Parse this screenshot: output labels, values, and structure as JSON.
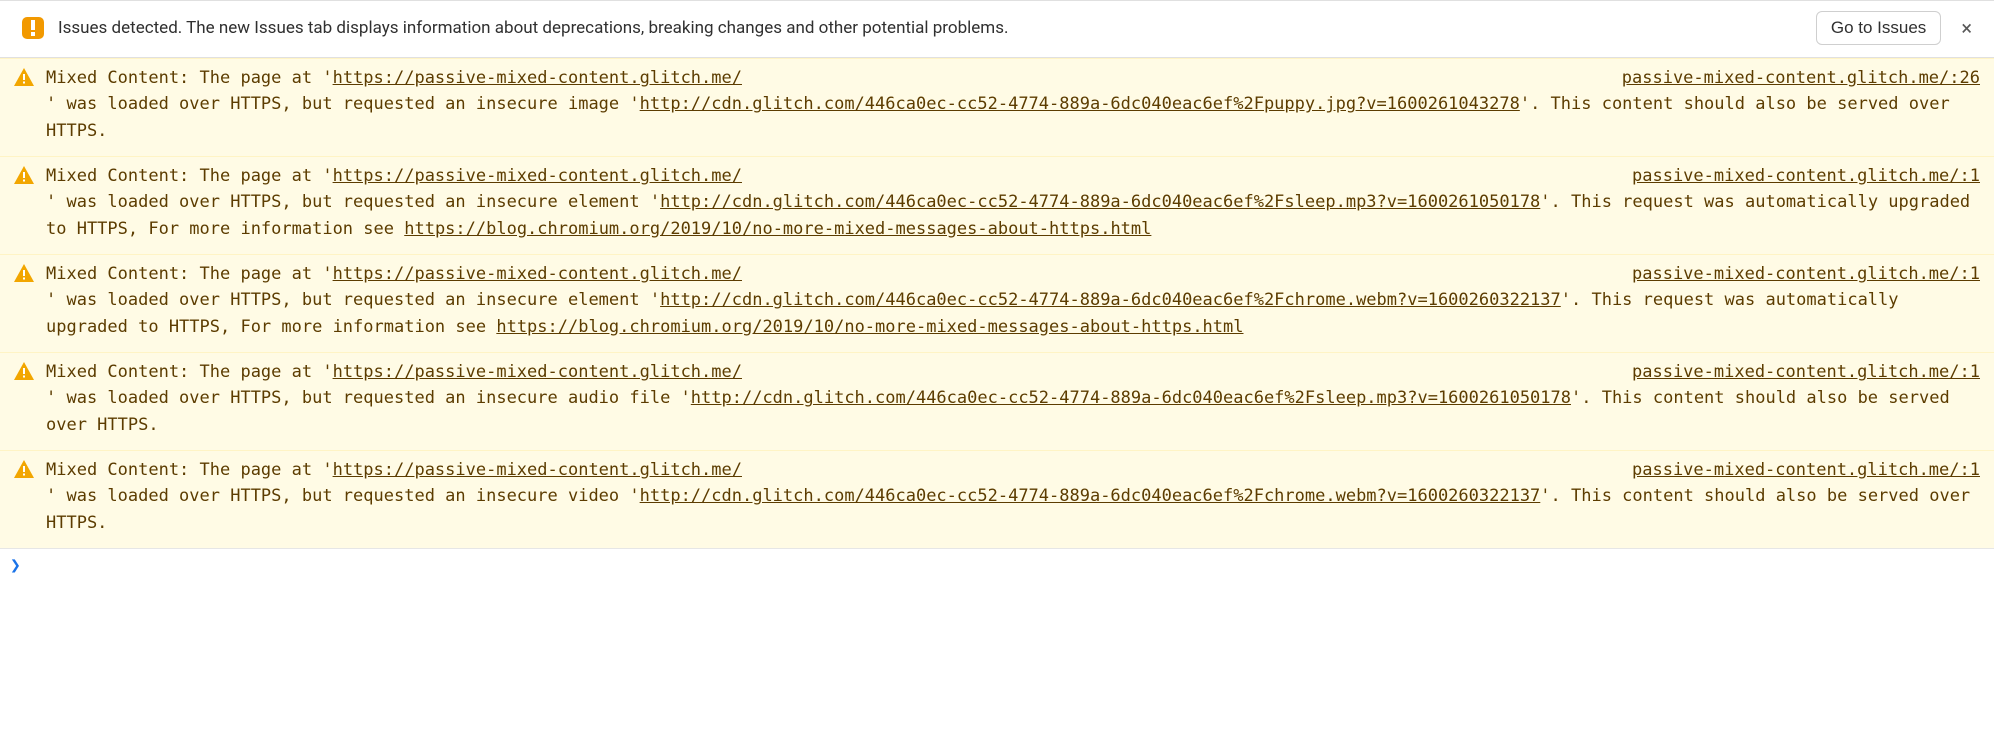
{
  "banner": {
    "text": "Issues detected. The new Issues tab displays information about deprecations, breaking changes and other potential problems.",
    "button": "Go to Issues",
    "close": "×"
  },
  "prompt": {
    "caret": "❯"
  },
  "rows": [
    {
      "source": "passive-mixed-content.glitch.me/:26",
      "parts": [
        {
          "t": "Mixed Content: The page at '"
        },
        {
          "t": "https://passive-mixed-content.glitch.me/",
          "link": true
        },
        {
          "t": "' was loaded over HTTPS, but requested an insecure image '"
        },
        {
          "t": "http://cdn.glitch.com/446ca0ec-cc52-4774-889a-6dc040eac6ef%2Fpuppy.jpg?v=1600261043278",
          "link": true
        },
        {
          "t": "'. This content should also be served over HTTPS."
        }
      ]
    },
    {
      "source": "passive-mixed-content.glitch.me/:1",
      "parts": [
        {
          "t": "Mixed Content: The page at '"
        },
        {
          "t": "https://passive-mixed-content.glitch.me/",
          "link": true
        },
        {
          "t": "' was loaded over HTTPS, but requested an insecure element '"
        },
        {
          "t": "http://cdn.glitch.com/446ca0ec-cc52-4774-889a-6dc040eac6ef%2Fsleep.mp3?v=1600261050178",
          "link": true
        },
        {
          "t": "'. This request was automatically upgraded to HTTPS, For more information see "
        },
        {
          "t": "https://blog.chromium.org/2019/10/no-more-mixed-messages-about-https.html",
          "link": true
        }
      ]
    },
    {
      "source": "passive-mixed-content.glitch.me/:1",
      "parts": [
        {
          "t": "Mixed Content: The page at '"
        },
        {
          "t": "https://passive-mixed-content.glitch.me/",
          "link": true
        },
        {
          "t": "' was loaded over HTTPS, but requested an insecure element '"
        },
        {
          "t": "http://cdn.glitch.com/446ca0ec-cc52-4774-889a-6dc040eac6ef%2Fchrome.webm?v=1600260322137",
          "link": true
        },
        {
          "t": "'. This request was automatically upgraded to HTTPS, For more information see "
        },
        {
          "t": "https://blog.chromium.org/2019/10/no-more-mixed-messages-about-https.html",
          "link": true
        }
      ]
    },
    {
      "source": "passive-mixed-content.glitch.me/:1",
      "parts": [
        {
          "t": "Mixed Content: The page at '"
        },
        {
          "t": "https://passive-mixed-content.glitch.me/",
          "link": true
        },
        {
          "t": "' was loaded over HTTPS, but requested an insecure audio file '"
        },
        {
          "t": "http://cdn.glitch.com/446ca0ec-cc52-4774-889a-6dc040eac6ef%2Fsleep.mp3?v=1600261050178",
          "link": true
        },
        {
          "t": "'. This content should also be served over HTTPS."
        }
      ]
    },
    {
      "source": "passive-mixed-content.glitch.me/:1",
      "parts": [
        {
          "t": "Mixed Content: The page at '"
        },
        {
          "t": "https://passive-mixed-content.glitch.me/",
          "link": true
        },
        {
          "t": "' was loaded over HTTPS, but requested an insecure video '"
        },
        {
          "t": "http://cdn.glitch.com/446ca0ec-cc52-4774-889a-6dc040eac6ef%2Fchrome.webm?v=1600260322137",
          "link": true
        },
        {
          "t": "'. This content should also be served over HTTPS."
        }
      ]
    }
  ]
}
